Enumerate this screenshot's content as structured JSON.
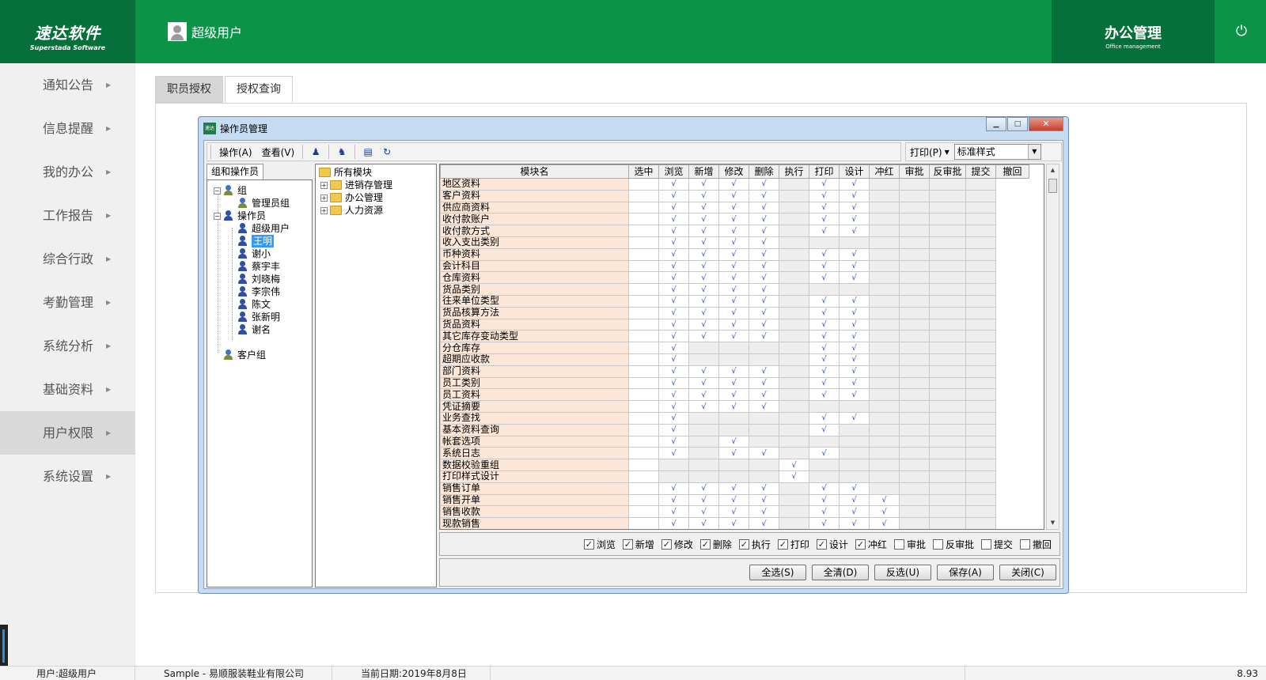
{
  "brand": {
    "name": "速达软件",
    "sub": "Superstada Software"
  },
  "header": {
    "user": "超级用户",
    "module_title": "办公管理",
    "module_sub": "Office management"
  },
  "sidebar": {
    "items": [
      {
        "label": "通知公告"
      },
      {
        "label": "信息提醒"
      },
      {
        "label": "我的办公"
      },
      {
        "label": "工作报告"
      },
      {
        "label": "综合行政"
      },
      {
        "label": "考勤管理"
      },
      {
        "label": "系统分析"
      },
      {
        "label": "基础资料"
      },
      {
        "label": "用户权限"
      },
      {
        "label": "系统设置"
      }
    ],
    "active_index": 8
  },
  "tabs": [
    {
      "label": "职员授权"
    },
    {
      "label": "授权查询"
    }
  ],
  "dialog": {
    "title": "操作员管理",
    "icon_text": "速达",
    "menu": {
      "operate": "操作(A)",
      "view": "查看(V)"
    },
    "print_label": "打印(P)",
    "style_value": "标准样式",
    "left_tab": "组和操作员",
    "tree": {
      "group": "组",
      "admin_group": "管理员组",
      "operators": "操作员",
      "users": [
        "超级用户",
        "王明",
        "谢小",
        "蔡宇丰",
        "刘晓梅",
        "李宗伟",
        "陈文",
        "张新明",
        "谢名"
      ],
      "selected_user": "王明",
      "customer_group": "客户组"
    },
    "modules": {
      "root": "所有模块",
      "children": [
        "进销存管理",
        "办公管理",
        "人力资源"
      ]
    },
    "grid": {
      "columns": [
        "模块名",
        "选中",
        "浏览",
        "新增",
        "修改",
        "删除",
        "执行",
        "打印",
        "设计",
        "冲红",
        "审批",
        "反审批",
        "提交",
        "撤回"
      ],
      "rows": [
        {
          "name": "地区资料",
          "flags": "011110110000"
        },
        {
          "name": "客户资料",
          "flags": "011110110000"
        },
        {
          "name": "供应商资料",
          "flags": "011110110000"
        },
        {
          "name": "收付款账户",
          "flags": "011110110000"
        },
        {
          "name": "收付款方式",
          "flags": "011110110000"
        },
        {
          "name": "收入支出类别",
          "flags": "011110000000"
        },
        {
          "name": "币种资料",
          "flags": "011110110000"
        },
        {
          "name": "会计科目",
          "flags": "011110110000"
        },
        {
          "name": "仓库资料",
          "flags": "011110110000"
        },
        {
          "name": "货品类别",
          "flags": "011110000000"
        },
        {
          "name": "往来单位类型",
          "flags": "011110110000"
        },
        {
          "name": "货品核算方法",
          "flags": "011110110000"
        },
        {
          "name": "货品资料",
          "flags": "011110110000"
        },
        {
          "name": "其它库存变动类型",
          "flags": "011110110000"
        },
        {
          "name": "分仓库存",
          "flags": "010000110000"
        },
        {
          "name": "超期应收款",
          "flags": "010000110000"
        },
        {
          "name": "部门资料",
          "flags": "011110110000"
        },
        {
          "name": "员工类别",
          "flags": "011110110000"
        },
        {
          "name": "员工资料",
          "flags": "011110110000"
        },
        {
          "name": "凭证摘要",
          "flags": "011110000000"
        },
        {
          "name": "业务查找",
          "flags": "010000110000"
        },
        {
          "name": "基本资料查询",
          "flags": "010000100000"
        },
        {
          "name": "帐套选项",
          "flags": "010100000000"
        },
        {
          "name": "系统日志",
          "flags": "010110100000"
        },
        {
          "name": "数据校验重组",
          "flags": "000001000000"
        },
        {
          "name": "打印样式设计",
          "flags": "000001000000"
        },
        {
          "name": "销售订单",
          "flags": "011110110000"
        },
        {
          "name": "销售开单",
          "flags": "011110111000"
        },
        {
          "name": "销售收款",
          "flags": "011110111000"
        },
        {
          "name": "现款销售",
          "flags": "011110111000"
        }
      ],
      "avail": [
        "011110110000",
        "011110110000",
        "011110110000",
        "011110110000",
        "011110110000",
        "011110000000",
        "011110110000",
        "011110110000",
        "011110110000",
        "011110000000",
        "011110110000",
        "011110110000",
        "011110110000",
        "011110110000",
        "010000110000",
        "010000110000",
        "011110110000",
        "011110110000",
        "011110110000",
        "011110000000",
        "010000110000",
        "010000100000",
        "010100000000",
        "010110100000",
        "000001000000",
        "000001000000",
        "011110110000",
        "011110111000",
        "011110111000",
        "011110111000"
      ]
    },
    "checks": [
      {
        "label": "浏览",
        "checked": true
      },
      {
        "label": "新增",
        "checked": true
      },
      {
        "label": "修改",
        "checked": true
      },
      {
        "label": "删除",
        "checked": true
      },
      {
        "label": "执行",
        "checked": true
      },
      {
        "label": "打印",
        "checked": true
      },
      {
        "label": "设计",
        "checked": true
      },
      {
        "label": "冲红",
        "checked": true
      },
      {
        "label": "审批",
        "checked": false
      },
      {
        "label": "反审批",
        "checked": false
      },
      {
        "label": "提交",
        "checked": false
      },
      {
        "label": "撤回",
        "checked": false
      }
    ],
    "buttons": {
      "select_all": "全选(S)",
      "clear_all": "全清(D)",
      "invert": "反选(U)",
      "save": "保存(A)",
      "close": "关闭(C)"
    }
  },
  "status": {
    "user": "用户:超级用户",
    "company": "Sample - 易顺服装鞋业有限公司",
    "date": "当前日期:2019年8月8日",
    "version": "8.93"
  },
  "check_mark": "√"
}
